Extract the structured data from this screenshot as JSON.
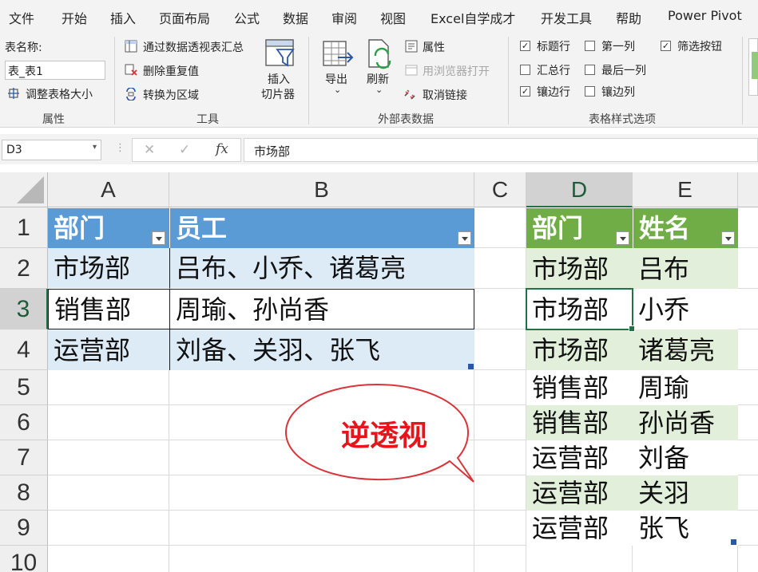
{
  "ribbon_tabs": [
    "文件",
    "开始",
    "插入",
    "页面布局",
    "公式",
    "数据",
    "审阅",
    "视图",
    "Excel自学成才",
    "开发工具",
    "帮助",
    "Power Pivot"
  ],
  "properties_group": {
    "table_name_label": "表名称:",
    "table_name_value": "表_表1",
    "resize_label": "调整表格大小",
    "group_label": "属性"
  },
  "tools_group": {
    "pivot_summary": "通过数据透视表汇总",
    "remove_duplicates": "删除重复值",
    "convert_to_range": "转换为区域",
    "insert_slicer_line1": "插入",
    "insert_slicer_line2": "切片器",
    "group_label": "工具"
  },
  "external_group": {
    "export": "导出",
    "refresh": "刷新",
    "properties": "属性",
    "open_in_browser": "用浏览器打开",
    "unlink": "取消链接",
    "group_label": "外部表数据"
  },
  "style_options_group": {
    "header_row": "标题行",
    "first_column": "第一列",
    "filter_button": "筛选按钮",
    "total_row": "汇总行",
    "last_column": "最后一列",
    "banded_rows": "镶边行",
    "banded_columns": "镶边列",
    "group_label": "表格样式选项",
    "checked": {
      "header_row": "✓",
      "first_column": "",
      "filter_button": "✓",
      "total_row": "",
      "last_column": "",
      "banded_rows": "✓",
      "banded_columns": ""
    }
  },
  "formula_bar": {
    "name_box": "D3",
    "formula": "市场部"
  },
  "columns": [
    "A",
    "B",
    "C",
    "D",
    "E"
  ],
  "rows": [
    "1",
    "2",
    "3",
    "4",
    "5",
    "6",
    "7",
    "8",
    "9",
    "10"
  ],
  "table1": {
    "headers": [
      "部门",
      "员工"
    ],
    "rows": [
      [
        "市场部",
        "吕布、小乔、诸葛亮"
      ],
      [
        "销售部",
        "周瑜、孙尚香"
      ],
      [
        "运营部",
        "刘备、关羽、张飞"
      ]
    ]
  },
  "table2": {
    "headers": [
      "部门",
      "姓名"
    ],
    "rows": [
      [
        "市场部",
        "吕布"
      ],
      [
        "市场部",
        "小乔"
      ],
      [
        "市场部",
        "诸葛亮"
      ],
      [
        "销售部",
        "周瑜"
      ],
      [
        "销售部",
        "孙尚香"
      ],
      [
        "运营部",
        "刘备"
      ],
      [
        "运营部",
        "关羽"
      ],
      [
        "运营部",
        "张飞"
      ]
    ]
  },
  "callout_text": "逆透视",
  "colors": {
    "table1_header": "#5b9bd5",
    "table1_band": "#ddebf7",
    "table2_header": "#70ad47",
    "table2_band": "#e2efda",
    "callout_text": "#e8141c",
    "selection": "#217346"
  }
}
